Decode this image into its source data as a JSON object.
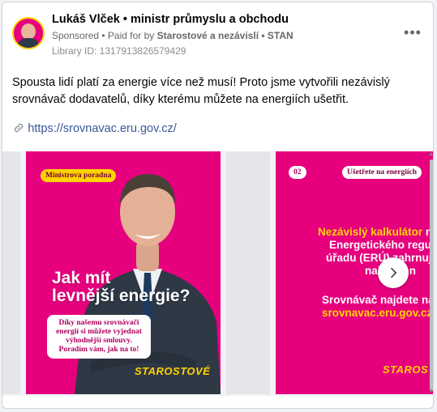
{
  "post": {
    "page_name": "Lukáš Vlček • ministr průmyslu a obchodu",
    "sponsored_label": "Sponsored",
    "paid_prefix": "• Paid for by",
    "payer": "Starostové a nezávislí • STAN",
    "library_id": "Library ID: 1317913826579429",
    "more_label": "•••",
    "body_text": "Spousta lidí platí za energie více než musí! Proto jsme vytvořili nezávislý srovnávač dodavatelů, díky kterému můžete na energiích ušetřit.",
    "link_icon": "link-icon",
    "link_text": "https://srovnavac.eru.gov.cz/"
  },
  "carousel": {
    "slide1": {
      "tag": "Ministrova poradna",
      "headline_line1": "Jak mít",
      "headline_line2": "levnější energie?",
      "note": "Díky našemu srovnávači energií si můžete vyjednat výhodnější smlouvy. Poradím vám, jak na to!",
      "brand": "STAROSTOVÉ"
    },
    "slide2": {
      "number": "02",
      "tag": "Ušetřete na energiích",
      "line1_yellow": "Nezávislý kalkulátor",
      "line1_white": " na we",
      "line2": "Energetického regulační",
      "line3": "úřadu (ERÚ) zahrnuje všech",
      "line4": "nabídky n",
      "lower_line1": "Srovnávač najdete na",
      "lower_line2": "srovnavac.eru.gov.cz",
      "brand": "STAROS"
    },
    "next_icon": "chevron-right-icon"
  },
  "colors": {
    "magenta": "#e6007e",
    "yellow": "#ffd400",
    "link": "#385898"
  }
}
